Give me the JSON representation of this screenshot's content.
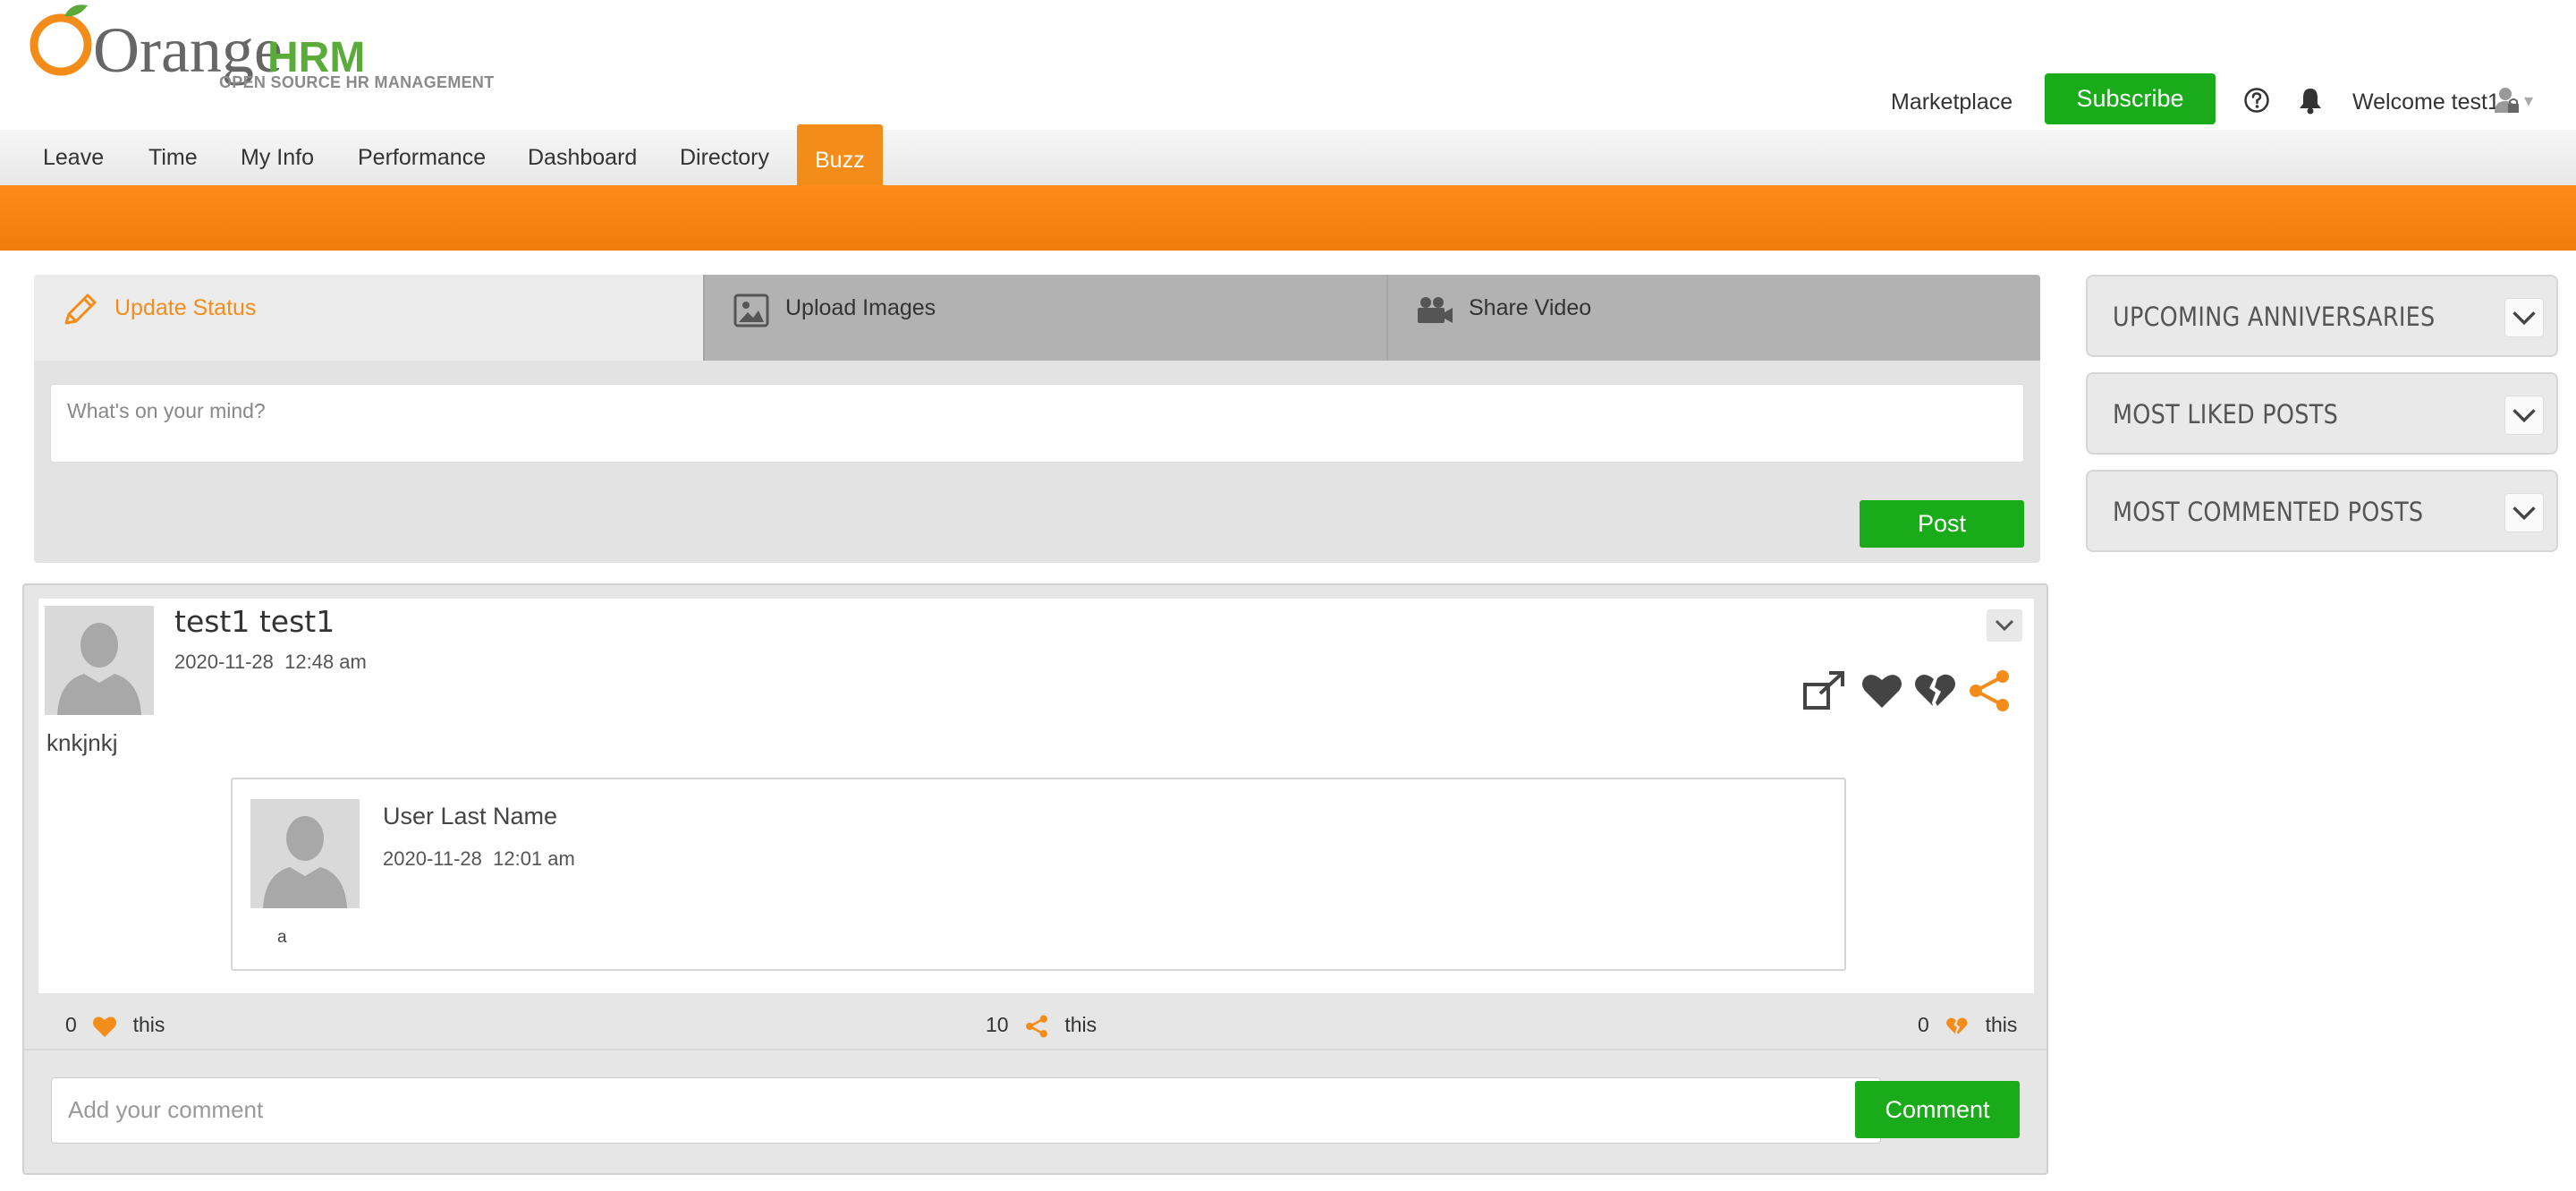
{
  "brand": {
    "name_orange": "Orange",
    "name_hrm": "HRM",
    "tagline": "OPEN SOURCE HR MANAGEMENT"
  },
  "header": {
    "marketplace": "Marketplace",
    "subscribe": "Subscribe",
    "welcome": "Welcome test1"
  },
  "nav": {
    "items": [
      {
        "label": "Leave"
      },
      {
        "label": "Time"
      },
      {
        "label": "My Info"
      },
      {
        "label": "Performance"
      },
      {
        "label": "Dashboard"
      },
      {
        "label": "Directory"
      },
      {
        "label": "Buzz"
      }
    ],
    "active": "Buzz"
  },
  "status": {
    "tabs": [
      {
        "label": "Update Status",
        "icon": "pencil-icon"
      },
      {
        "label": "Upload Images",
        "icon": "image-icon"
      },
      {
        "label": "Share Video",
        "icon": "video-camera-icon"
      }
    ],
    "placeholder": "What's on your mind?",
    "post_label": "Post"
  },
  "post": {
    "author": "test1 test1",
    "date": "2020-11-28",
    "time": "12:48 am",
    "text": "knkjnkj",
    "shared": {
      "author": "User Last Name",
      "date": "2020-11-28",
      "time": "12:01 am",
      "text": "a"
    },
    "likes": {
      "count": "0",
      "suffix": "this"
    },
    "shares": {
      "count": "10",
      "suffix": "this"
    },
    "dislikes": {
      "count": "0",
      "suffix": "this"
    },
    "comment_placeholder": "Add your comment",
    "comment_label": "Comment"
  },
  "widgets": [
    {
      "title": "UPCOMING ANNIVERSARIES"
    },
    {
      "title": "MOST LIKED POSTS"
    },
    {
      "title": "MOST COMMENTED POSTS"
    }
  ],
  "colors": {
    "brand_orange": "#f48c1a",
    "brand_green": "#1aab1a",
    "logo_green": "#5aab3a"
  }
}
